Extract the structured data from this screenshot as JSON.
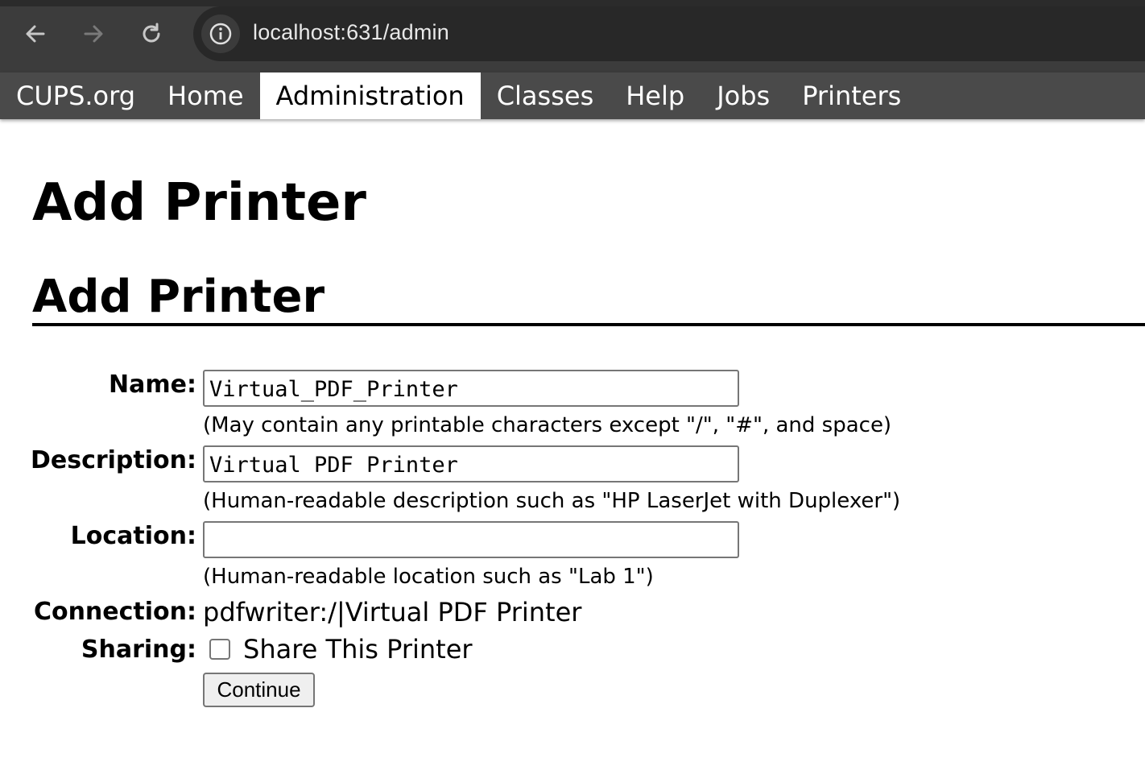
{
  "browser": {
    "url": "localhost:631/admin",
    "back_icon": "arrow-left-icon",
    "forward_icon": "arrow-right-icon",
    "reload_icon": "reload-icon",
    "site_info_icon": "info-icon"
  },
  "nav": {
    "tabs": [
      {
        "label": "CUPS.org",
        "active": false
      },
      {
        "label": "Home",
        "active": false
      },
      {
        "label": "Administration",
        "active": true
      },
      {
        "label": "Classes",
        "active": false
      },
      {
        "label": "Help",
        "active": false
      },
      {
        "label": "Jobs",
        "active": false
      },
      {
        "label": "Printers",
        "active": false
      }
    ]
  },
  "page": {
    "title": "Add Printer",
    "section_title": "Add Printer"
  },
  "form": {
    "name": {
      "label": "Name:",
      "value": "Virtual_PDF_Printer",
      "hint": "(May contain any printable characters except \"/\", \"#\", and space)"
    },
    "description": {
      "label": "Description:",
      "value": "Virtual PDF Printer",
      "hint": "(Human-readable description such as \"HP LaserJet with Duplexer\")"
    },
    "location": {
      "label": "Location:",
      "value": "",
      "hint": "(Human-readable location such as \"Lab 1\")"
    },
    "connection": {
      "label": "Connection:",
      "value": "pdfwriter:/|Virtual PDF Printer"
    },
    "sharing": {
      "label": "Sharing:",
      "checkbox_label": "Share This Printer",
      "checked": false
    },
    "submit_label": "Continue"
  },
  "colors": {
    "chrome_bg": "#3c3c3c",
    "omnibox_bg": "#282828",
    "nav_bg": "#4a4a4a",
    "nav_active_bg": "#ffffff"
  }
}
